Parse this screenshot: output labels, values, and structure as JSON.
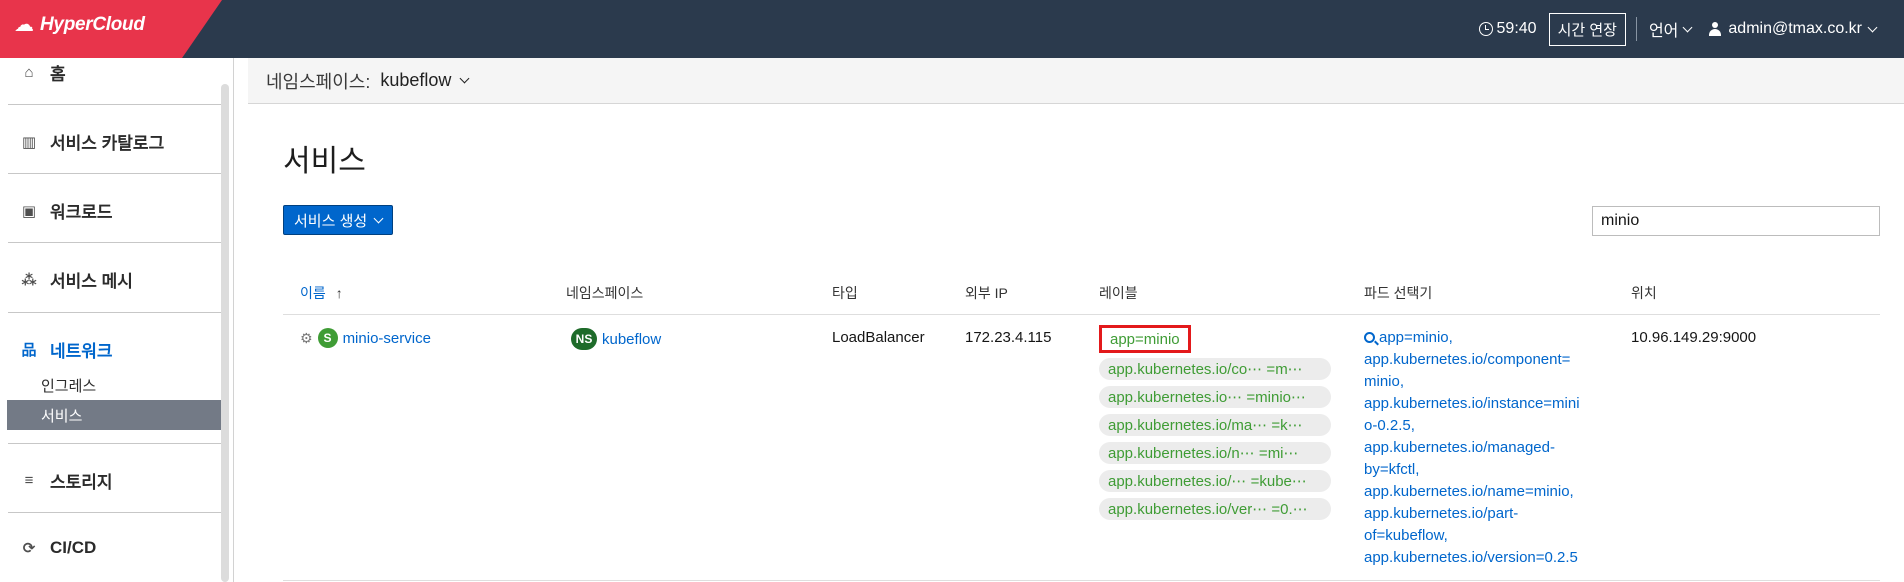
{
  "header": {
    "brand": "HyperCloud",
    "timer": "59:40",
    "extend_label": "시간 연장",
    "language_label": "언어",
    "user": "admin@tmax.co.kr"
  },
  "sidebar": {
    "items": [
      {
        "label": "홈",
        "icon": "home-icon"
      },
      {
        "label": "서비스 카탈로그",
        "icon": "catalog-icon"
      },
      {
        "label": "워크로드",
        "icon": "briefcase-icon"
      },
      {
        "label": "서비스 메시",
        "icon": "mesh-icon"
      },
      {
        "label": "네트워크",
        "icon": "network-icon"
      },
      {
        "label": "스토리지",
        "icon": "database-icon"
      },
      {
        "label": "CI/CD",
        "icon": "cicd-icon"
      }
    ],
    "network_sub": [
      "인그레스",
      "서비스"
    ],
    "selected": "서비스"
  },
  "namespace_bar": {
    "label": "네임스페이스:",
    "value": "kubeflow"
  },
  "page": {
    "title": "서비스",
    "create_button": "서비스 생성",
    "search_value": "minio"
  },
  "table": {
    "headers": [
      "이름",
      "네임스페이스",
      "타입",
      "외부 IP",
      "레이블",
      "파드 선택기",
      "위치"
    ],
    "row": {
      "name_badge": "S",
      "name": "minio-service",
      "ns_badge": "NS",
      "namespace": "kubeflow",
      "type": "LoadBalancer",
      "external_ip": "172.23.4.115",
      "labels": [
        "app=minio",
        "app.kubernetes.io/co⋯  =m⋯",
        "app.kubernetes.io⋯ =minio⋯",
        "app.kubernetes.io/ma⋯  =k⋯",
        "app.kubernetes.io/n⋯  =mi⋯",
        "app.kubernetes.io/⋯ =kube⋯",
        "app.kubernetes.io/ver⋯ =0.⋯"
      ],
      "selector_lines": [
        "app=minio,",
        "app.kubernetes.io/component=",
        "minio,",
        "app.kubernetes.io/instance=mini",
        "o-0.2.5,",
        "app.kubernetes.io/managed-",
        "by=kfctl,",
        "app.kubernetes.io/name=minio,",
        "app.kubernetes.io/part-",
        "of=kubeflow,",
        "app.kubernetes.io/version=0.2.5"
      ],
      "location": "10.96.149.29:9000"
    }
  },
  "colors": {
    "topbar": "#2b3a4d",
    "brand": "#e8344b",
    "accent": "#0066cc",
    "label_green": "#3f9c35",
    "service_badge": "#3f9c35",
    "ns_badge": "#1e6b2a",
    "highlight": "#e3191b"
  }
}
